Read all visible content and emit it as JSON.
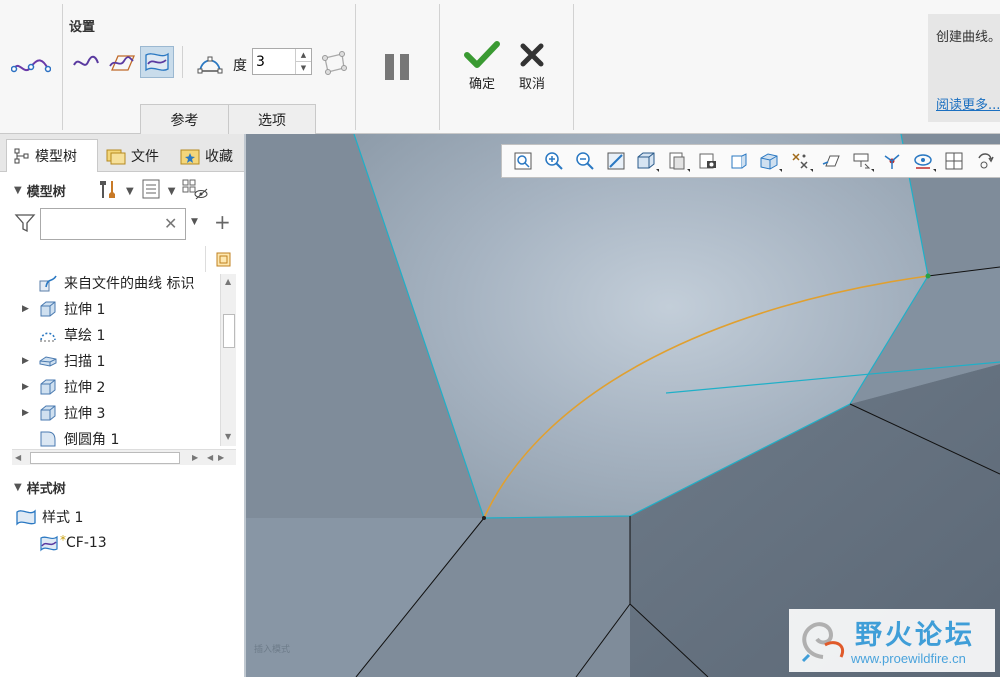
{
  "ribbon": {
    "settings_title": "设置",
    "degree_label": "度",
    "degree_value": "3",
    "tabs": [
      {
        "label": "参考"
      },
      {
        "label": "选项"
      }
    ],
    "confirm_label": "确定",
    "cancel_label": "取消",
    "help_text": "创建曲线。",
    "help_link": "阅读更多..."
  },
  "panel_tabs": [
    {
      "label": "模型树"
    },
    {
      "label": "文件"
    },
    {
      "label": "收藏"
    }
  ],
  "model_tree": {
    "title": "模型树",
    "filter_value": "",
    "items": [
      {
        "label": "来自文件的曲线 标识",
        "expandable": false
      },
      {
        "label": "拉伸 1",
        "expandable": true
      },
      {
        "label": "草绘 1",
        "expandable": false
      },
      {
        "label": "扫描 1",
        "expandable": true
      },
      {
        "label": "拉伸 2",
        "expandable": true
      },
      {
        "label": "拉伸 3",
        "expandable": true
      },
      {
        "label": "倒圆角 1",
        "expandable": false
      }
    ]
  },
  "style_tree": {
    "title": "样式树",
    "style_item": "样式 1",
    "curve_item": "CF-13",
    "curve_marker": "*"
  },
  "viewport": {
    "mode_text": "插入模式",
    "watermark_title": "野火论坛",
    "watermark_url": "www.proewildfire.cn"
  },
  "colors": {
    "accent_blue": "#2a78c2",
    "selected_curve": "#e0a030",
    "edge_cyan": "#1fb0c8",
    "confirm_green": "#3a9a32",
    "watermark_blue": "#3f9ed8"
  }
}
